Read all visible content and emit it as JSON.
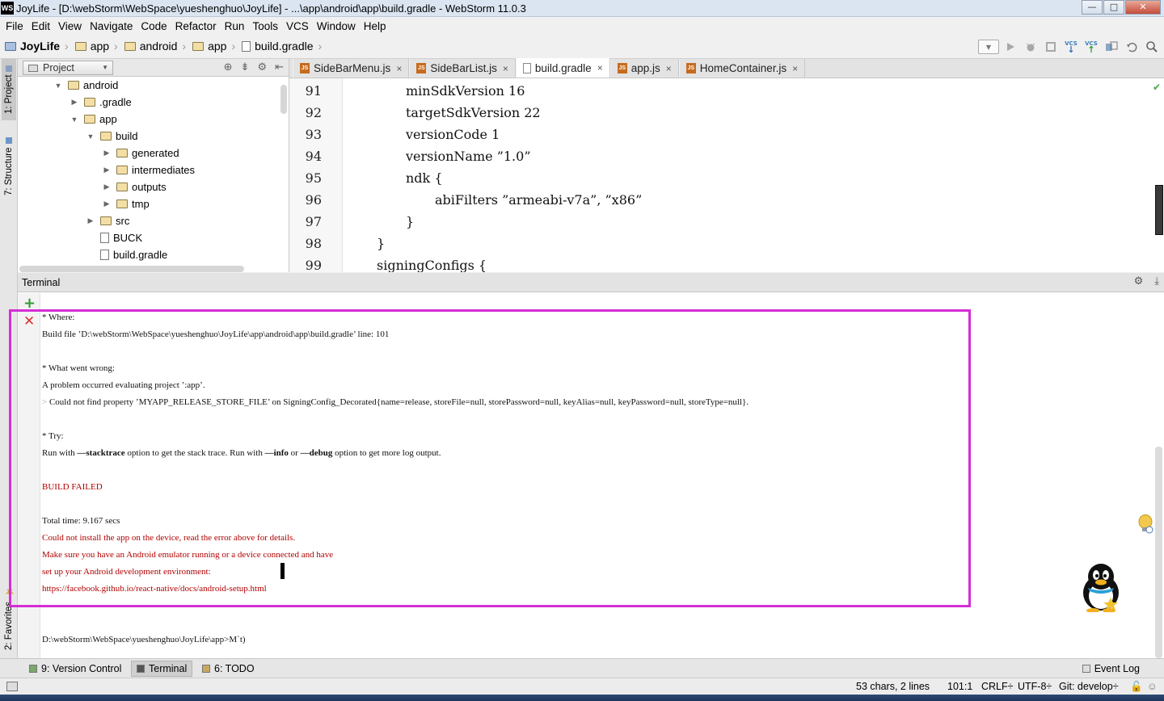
{
  "window": {
    "title": "JoyLife - [D:\\webStorm\\WebSpace\\yueshenghuo\\JoyLife] - ...\\app\\android\\app\\build.gradle - WebStorm 11.0.3",
    "logo": "WS",
    "minimize": "—",
    "maximize": "□",
    "close": "✕"
  },
  "menu": [
    "File",
    "Edit",
    "View",
    "Navigate",
    "Code",
    "Refactor",
    "Run",
    "Tools",
    "VCS",
    "Window",
    "Help"
  ],
  "breadcrumb": [
    "JoyLife",
    "app",
    "android",
    "app",
    "build.gradle"
  ],
  "navbar_icons": [
    "run-config-dropdown",
    "run-icon",
    "debug-icon",
    "coverage-icon",
    "vcs-update-icon",
    "vcs-commit-icon",
    "compare-icon",
    "revert-icon",
    "search-icon"
  ],
  "vcs_label": "VCS",
  "left_stripe": {
    "project": "1: Project",
    "structure": "7: Structure",
    "favorites": "2: Favorites"
  },
  "project_panel": {
    "view_selector": "Project",
    "tree": [
      {
        "label": "android",
        "type": "folder",
        "depth": 0,
        "expanded": true
      },
      {
        "label": ".gradle",
        "type": "folder",
        "depth": 1,
        "expanded": false
      },
      {
        "label": "app",
        "type": "folder",
        "depth": 1,
        "expanded": true
      },
      {
        "label": "build",
        "type": "folder",
        "depth": 2,
        "expanded": true
      },
      {
        "label": "generated",
        "type": "folder",
        "depth": 3,
        "expanded": false
      },
      {
        "label": "intermediates",
        "type": "folder",
        "depth": 3,
        "expanded": false
      },
      {
        "label": "outputs",
        "type": "folder",
        "depth": 3,
        "expanded": false
      },
      {
        "label": "tmp",
        "type": "folder",
        "depth": 3,
        "expanded": false
      },
      {
        "label": "src",
        "type": "folder",
        "depth": 2,
        "expanded": false
      },
      {
        "label": "BUCK",
        "type": "file",
        "depth": 2
      },
      {
        "label": "build.gradle",
        "type": "file",
        "depth": 2
      }
    ]
  },
  "editor": {
    "tabs": [
      {
        "label": "SideBarMenu.js",
        "icon": "js",
        "active": false
      },
      {
        "label": "SideBarList.js",
        "icon": "js",
        "active": false
      },
      {
        "label": "build.gradle",
        "icon": "gradle",
        "active": true
      },
      {
        "label": "app.js",
        "icon": "js",
        "active": false
      },
      {
        "label": "HomeContainer.js",
        "icon": "js",
        "active": false
      }
    ],
    "close_glyph": "×",
    "lines": [
      {
        "n": "91",
        "text": "minSdkVersion 16",
        "indent": 2
      },
      {
        "n": "92",
        "text": "targetSdkVersion 22",
        "indent": 2
      },
      {
        "n": "93",
        "text": "versionCode 1",
        "indent": 2
      },
      {
        "n": "94",
        "text": "versionName ”1.0”",
        "indent": 2
      },
      {
        "n": "95",
        "text": "ndk {",
        "indent": 2
      },
      {
        "n": "96",
        "text": "abiFilters ”armeabi-v7a”, ”x86”",
        "indent": 3
      },
      {
        "n": "97",
        "text": "}",
        "indent": 2
      },
      {
        "n": "98",
        "text": "}",
        "indent": 1
      },
      {
        "n": "99",
        "text": "signingConfigs {",
        "indent": 1
      }
    ]
  },
  "terminal": {
    "title": "Terminal",
    "lines": [
      {
        "text": "* Where:",
        "style": "normal"
      },
      {
        "text": "Build file ’D:\\webStorm\\WebSpace\\yueshenghuo\\JoyLife\\app\\android\\app\\build.gradle’ line: 101",
        "style": "normal"
      },
      {
        "text": "",
        "style": "normal"
      },
      {
        "text": "* What went wrong:",
        "style": "normal"
      },
      {
        "text": "A problem occurred evaluating project ’:app’.",
        "style": "normal"
      },
      {
        "text": "Could not find property ’MYAPP_RELEASE_STORE_FILE’ on SigningConfig_Decorated{name=release, storeFile=null, storePassword=null, keyAlias=null, keyPassword=null, storeType=null}.",
        "style": "arrow"
      },
      {
        "text": "",
        "style": "normal"
      },
      {
        "text": "* Try:",
        "style": "normal"
      },
      {
        "text": "Run with —stacktrace option to get the stack trace. Run with —info or —debug option to get more log output.",
        "style": "try"
      },
      {
        "text": "",
        "style": "normal"
      },
      {
        "text": "BUILD FAILED",
        "style": "red"
      },
      {
        "text": "",
        "style": "normal"
      },
      {
        "text": "Total time: 9.167 secs",
        "style": "normal"
      },
      {
        "text": "Could not install the app on the device, read the error above for details.",
        "style": "red"
      },
      {
        "text": "Make sure you have an Android emulator running or a device connected and have",
        "style": "red"
      },
      {
        "text": "set up your Android development environment:",
        "style": "red"
      },
      {
        "text": "https://facebook.github.io/react-native/docs/android-setup.html",
        "style": "red"
      },
      {
        "text": "",
        "style": "normal"
      },
      {
        "text": "",
        "style": "normal"
      },
      {
        "text": "D:\\webStorm\\WebSpace\\yueshenghuo\\JoyLife\\app>M`t)",
        "style": "normal"
      }
    ],
    "try_parts": [
      "Run with ",
      "—stacktrace",
      " option to get the stack trace. Run with ",
      "—info",
      " or ",
      "—debug",
      " option to get more log output."
    ],
    "arrow_glyph": ">",
    "add_glyph": "+",
    "close_glyph": "✕"
  },
  "tool_tabs": [
    {
      "label": "9: Version Control",
      "active": false
    },
    {
      "label": "Terminal",
      "active": true
    },
    {
      "label": "6: TODO",
      "active": false
    }
  ],
  "event_log": "Event Log",
  "status": {
    "selection": "53 chars, 2 lines",
    "position": "101:1",
    "line_sep": "CRLF÷",
    "encoding": "UTF-8÷",
    "git": "Git: develop÷"
  },
  "colors": {
    "highlight_box": "#d42ed4",
    "error_red": "#b00000",
    "add_green": "#2e9b2e"
  }
}
